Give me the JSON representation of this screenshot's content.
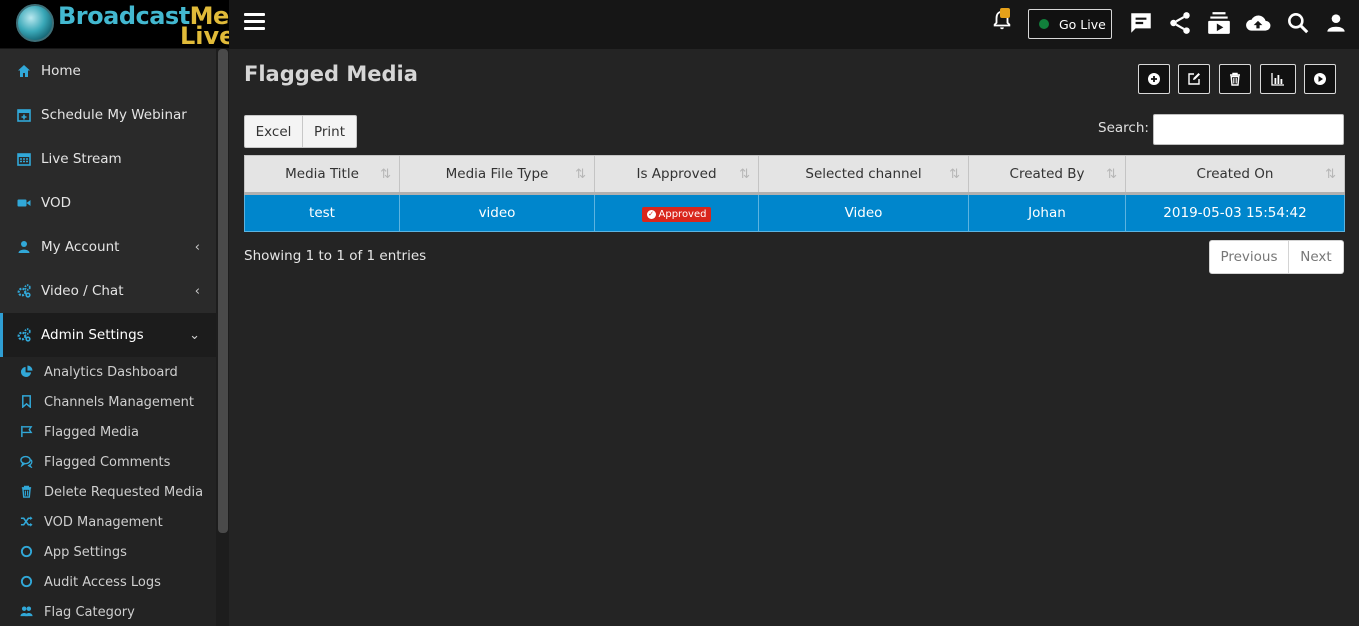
{
  "brand": {
    "line1a": "Broadcast",
    "line1b": "Me",
    "line2": "Live"
  },
  "topbar": {
    "go_live_label": "Go Live"
  },
  "sidebar": {
    "items": [
      {
        "label": "Home",
        "icon": "home-icon"
      },
      {
        "label": "Schedule My Webinar",
        "icon": "calendar-plus-icon"
      },
      {
        "label": "Live Stream",
        "icon": "calendar-icon"
      },
      {
        "label": "VOD",
        "icon": "video-camera-icon"
      },
      {
        "label": "My Account",
        "icon": "user-icon"
      },
      {
        "label": "Video / Chat",
        "icon": "cogs-icon"
      },
      {
        "label": "Admin Settings",
        "icon": "cogs-icon"
      }
    ],
    "admin_sub": [
      {
        "label": "Analytics Dashboard",
        "icon": "pie-chart-icon"
      },
      {
        "label": "Channels Management",
        "icon": "bookmark-icon"
      },
      {
        "label": "Flagged Media",
        "icon": "flag-icon"
      },
      {
        "label": "Flagged Comments",
        "icon": "comments-icon"
      },
      {
        "label": "Delete Requested Media",
        "icon": "trash-icon"
      },
      {
        "label": "VOD Management",
        "icon": "random-icon"
      },
      {
        "label": "App Settings",
        "icon": "circle-icon"
      },
      {
        "label": "Audit Access Logs",
        "icon": "circle-icon"
      },
      {
        "label": "Flag Category",
        "icon": "users-icon"
      }
    ]
  },
  "main": {
    "title": "Flagged Media",
    "export": {
      "excel": "Excel",
      "print": "Print"
    },
    "search": {
      "label": "Search:",
      "value": ""
    },
    "table": {
      "columns": [
        "Media Title",
        "Media File Type",
        "Is Approved",
        "Selected channel",
        "Created By",
        "Created On"
      ],
      "rows": [
        {
          "media_title": "test",
          "file_type": "video",
          "approved": "Approved",
          "channel": "Video",
          "created_by": "Johan",
          "created_on": "2019-05-03 15:54:42"
        }
      ]
    },
    "info": "Showing 1 to 1 of 1 entries",
    "pager": {
      "prev": "Previous",
      "next": "Next"
    }
  },
  "colors": {
    "accent": "#0086cc",
    "sidebar_icon": "#31a8d8",
    "badge": "#d9261c",
    "notification": "#e5a11a",
    "live_dot": "#11803b"
  }
}
